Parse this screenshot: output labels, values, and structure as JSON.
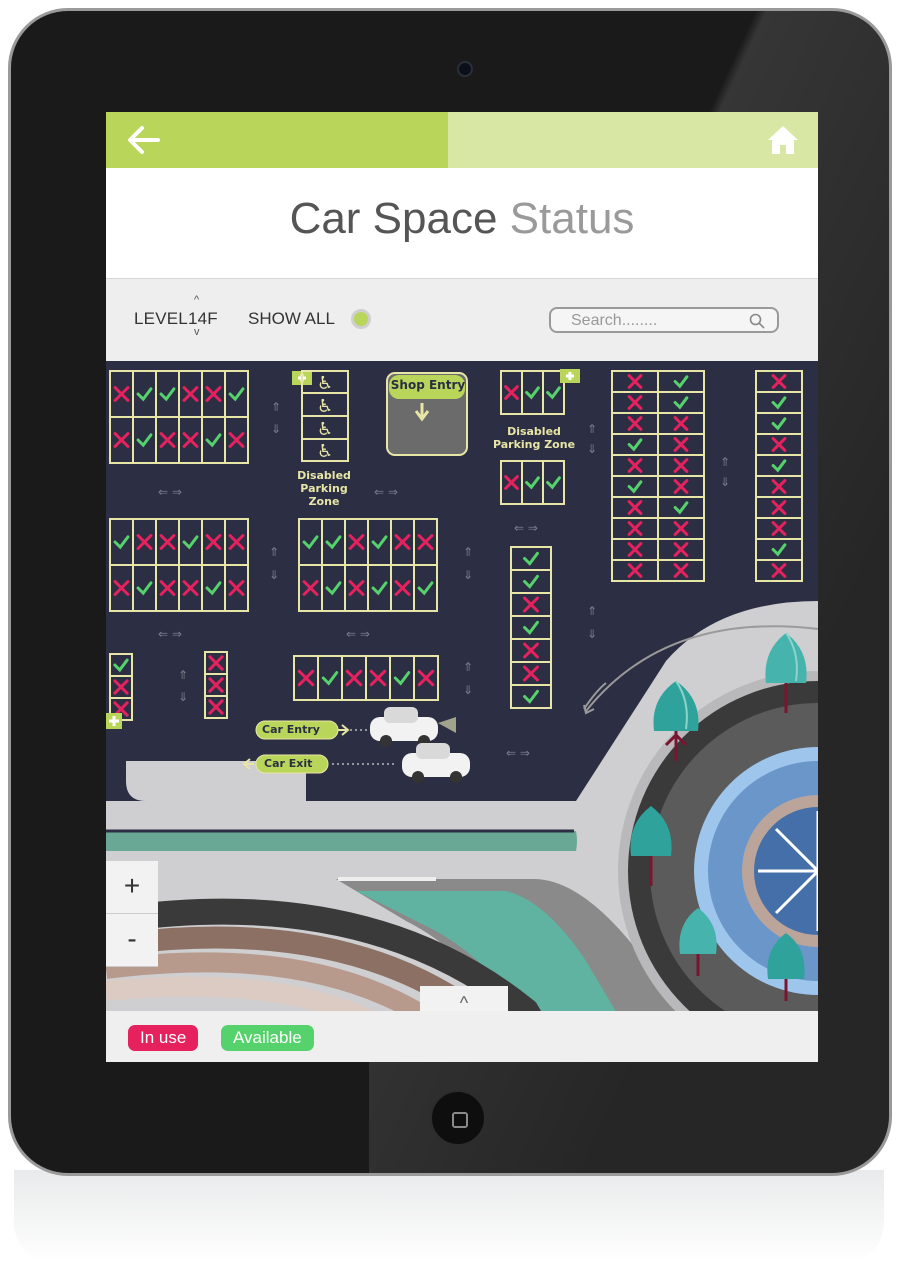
{
  "app": {
    "title_main": "Car Space",
    "title_light": " Status"
  },
  "toolbar": {
    "level_prefix": "LEVEL",
    "level_value": "14F",
    "level_up": "^",
    "level_down": "v",
    "show_all_label": "SHOW ALL",
    "search_placeholder": "Search........"
  },
  "map": {
    "labels": {
      "shop_entry": "Shop Entry",
      "disabled_zone_1_line1": "Disabled",
      "disabled_zone_1_line2": "Parking Zone",
      "disabled_zone_2_line1": "Disabled",
      "disabled_zone_2_line2": "Parking Zone",
      "car_entry": "Car Entry",
      "car_exit": "Car Exit"
    },
    "lots": {
      "A": [
        [
          "x",
          "v",
          "v",
          "x",
          "x",
          "v"
        ],
        [
          "x",
          "v",
          "x",
          "x",
          "v",
          "x"
        ]
      ],
      "B": [
        [
          "v",
          "x",
          "x",
          "v",
          "x",
          "x"
        ],
        [
          "x",
          "v",
          "x",
          "x",
          "v",
          "x"
        ]
      ],
      "C": [
        [
          "v",
          "v",
          "x",
          "v",
          "x",
          "x"
        ],
        [
          "x",
          "v",
          "x",
          "v",
          "x",
          "v"
        ]
      ],
      "D": [
        [
          "x",
          "v",
          "x",
          "x",
          "v",
          "x"
        ]
      ],
      "E": [
        "v",
        "x",
        "x"
      ],
      "F": [
        "x",
        "x",
        "x"
      ],
      "G": [
        "v",
        "v",
        "x",
        "v",
        "x",
        "x",
        "v"
      ],
      "H": [
        [
          "x",
          "v"
        ],
        [
          "x",
          "v"
        ],
        [
          "x",
          "x"
        ],
        [
          "v",
          "x"
        ],
        [
          "x",
          "x"
        ],
        [
          "v",
          "x"
        ],
        [
          "x",
          "v"
        ],
        [
          "x",
          "x"
        ],
        [
          "x",
          "x"
        ],
        [
          "x",
          "x"
        ]
      ],
      "I": [
        "x",
        "v",
        "v",
        "x",
        "v",
        "x",
        "x",
        "x",
        "v",
        "x"
      ],
      "J": [
        "x",
        "v",
        "v"
      ],
      "K": [
        "x",
        "v",
        "v"
      ]
    },
    "zoom_in": "+",
    "zoom_out": "-",
    "collapse": "^"
  },
  "legend": {
    "in_use": "In use",
    "available": "Available"
  },
  "colors": {
    "accent": "#b9d65a",
    "in_use": "#e5215e",
    "available": "#55d26b",
    "lot_border": "#e8e6a6",
    "asphalt": "#2c2e44"
  }
}
